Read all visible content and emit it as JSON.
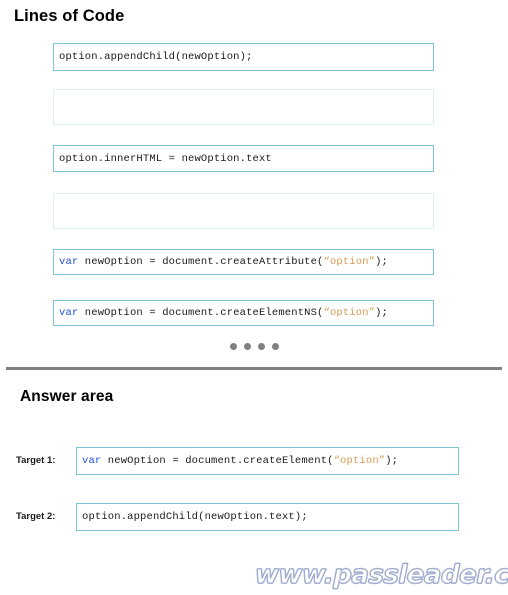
{
  "sections": {
    "lines_of_code": {
      "heading": "Lines of Code"
    },
    "answer_area": {
      "heading": "Answer area"
    }
  },
  "source_options": [
    {
      "id": "opt-append-child",
      "empty": false,
      "tokens": [
        {
          "type": "plain",
          "text": "option.appendChild(newOption);"
        }
      ],
      "plain_text": "option.appendChild(newOption);"
    },
    {
      "id": "opt-blank-1",
      "empty": true,
      "tokens": [],
      "plain_text": ""
    },
    {
      "id": "opt-inner-html",
      "empty": false,
      "tokens": [
        {
          "type": "plain",
          "text": "option.innerHTML = newOption.text"
        }
      ],
      "plain_text": "option.innerHTML = newOption.text"
    },
    {
      "id": "opt-blank-2",
      "empty": true,
      "tokens": [],
      "plain_text": ""
    },
    {
      "id": "opt-create-attribute",
      "empty": false,
      "tokens": [
        {
          "type": "keyword",
          "text": "var"
        },
        {
          "type": "plain",
          "text": " newOption = document.createAttribute("
        },
        {
          "type": "string",
          "text": "“option”"
        },
        {
          "type": "plain",
          "text": ");"
        }
      ],
      "plain_text": "var newOption = document.createAttribute(“option”);"
    },
    {
      "id": "opt-create-element-ns",
      "empty": false,
      "tokens": [
        {
          "type": "keyword",
          "text": "var"
        },
        {
          "type": "plain",
          "text": " newOption = document.createElementNS("
        },
        {
          "type": "string",
          "text": "“option”"
        },
        {
          "type": "plain",
          "text": ");"
        }
      ],
      "plain_text": "var newOption = document.createElementNS(“option”);"
    }
  ],
  "pagination": {
    "dot_count": 4,
    "dot_color": "#808080"
  },
  "targets": [
    {
      "id": "target-1",
      "label": "Target 1:",
      "tokens": [
        {
          "type": "keyword",
          "text": "var"
        },
        {
          "type": "plain",
          "text": " newOption = document.createElement("
        },
        {
          "type": "string",
          "text": "“option”"
        },
        {
          "type": "plain",
          "text": ");"
        }
      ],
      "plain_text": "var newOption = document.createElement(“option”);"
    },
    {
      "id": "target-2",
      "label": "Target 2:",
      "tokens": [
        {
          "type": "plain",
          "text": "option.appendChild(newOption.text);"
        }
      ],
      "plain_text": "option.appendChild(newOption.text);"
    }
  ],
  "watermark": {
    "text": "www.passleader.com"
  },
  "colors": {
    "keyword": "#1f4fd8",
    "string": "#d79b52",
    "box_border": "#7fc4d4",
    "box_border_empty": "#dfeef3",
    "divider": "#808080",
    "text": "#1a1a1a",
    "watermark_outline": "#b9c3dd"
  }
}
